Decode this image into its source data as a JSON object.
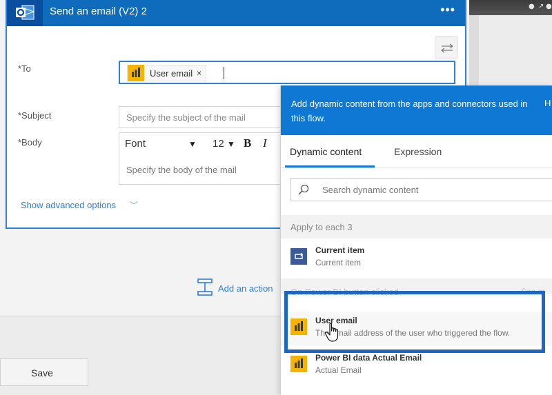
{
  "card": {
    "title": "Send an email (V2) 2",
    "more": "•••",
    "to_label": "*To",
    "subject_label": "*Subject",
    "body_label": "*Body",
    "to_token": {
      "label": "User email",
      "remove": "×"
    },
    "subject_placeholder": "Specify the subject of the mail",
    "body_toolbar": {
      "font": "Font",
      "size": "12",
      "bold": "B",
      "italic": "I",
      "arrow": "▼"
    },
    "body_placeholder": "Specify the body of the mail",
    "advanced_options": "Show advanced options",
    "advanced_chevron": "﹀"
  },
  "add_action_label": "Add an action",
  "save_label": "Save",
  "flyout": {
    "header_text": "Add dynamic content from the apps and connectors used in this flow.",
    "hide_label": "H",
    "tabs": [
      "Dynamic content",
      "Expression"
    ],
    "search_placeholder": "Search dynamic content",
    "groups": [
      {
        "title": "Apply to each 3"
      },
      {
        "title": "On Power BI button clicked",
        "see_more": "See m"
      }
    ],
    "items": [
      {
        "title": "Current item",
        "subtitle": "Current item"
      },
      {
        "title": "User email",
        "subtitle": "The email address of the user who triggered the flow."
      },
      {
        "title": "Power BI data Actual Email",
        "subtitle": "Actual Email"
      }
    ]
  },
  "colors": {
    "header_blue": "#0f6cbd",
    "flyout_blue": "#0f78d4",
    "power_bi_yellow": "#f5b400",
    "highlight_blue": "#1e67c1"
  }
}
